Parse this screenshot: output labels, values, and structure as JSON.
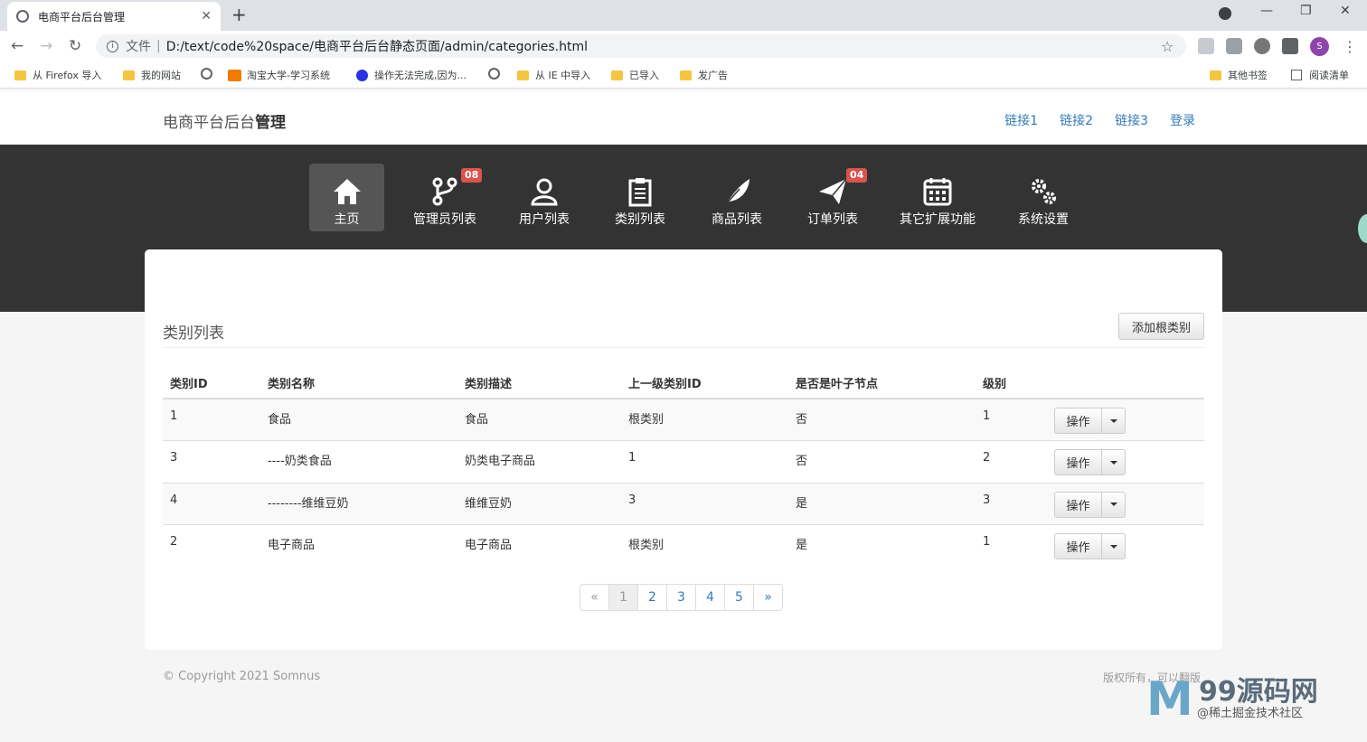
{
  "browser": {
    "tab_title": "电商平台后台管理",
    "url_prefix": "文件",
    "url": "D:/text/code%20space/电商平台后台静态页面/admin/categories.html",
    "avatar_letter": "S",
    "bookmarks": [
      "从 Firefox 导入",
      "我的网站",
      "淘宝大学-学习系统",
      "操作无法完成,因为...",
      "从 IE 中导入",
      "已导入",
      "发广告"
    ],
    "bookmarks_right": [
      "其他书签",
      "阅读清单"
    ]
  },
  "header": {
    "brand_normal": "电商平台后台",
    "brand_bold": "管理",
    "links": [
      "链接1",
      "链接2",
      "链接3",
      "登录"
    ]
  },
  "mainnav": {
    "items": [
      {
        "label": "主页",
        "icon": "home-icon"
      },
      {
        "label": "管理员列表",
        "icon": "branch-icon",
        "badge": "08"
      },
      {
        "label": "用户列表",
        "icon": "users-icon"
      },
      {
        "label": "类别列表",
        "icon": "clipboard-icon"
      },
      {
        "label": "商品列表",
        "icon": "feather-icon"
      },
      {
        "label": "订单列表",
        "icon": "send-icon",
        "badge": "04"
      },
      {
        "label": "其它扩展功能",
        "icon": "calendar-icon"
      },
      {
        "label": "系统设置",
        "icon": "cogs-icon"
      }
    ]
  },
  "card": {
    "title": "类别列表",
    "add_button": "添加根类别"
  },
  "table": {
    "headers": [
      "类别ID",
      "类别名称",
      "类别描述",
      "上一级类别ID",
      "是否是叶子节点",
      "级别",
      ""
    ],
    "rows": [
      [
        "1",
        "食品",
        "食品",
        "根类别",
        "否",
        "1"
      ],
      [
        "3",
        "----奶类食品",
        "奶类电子商品",
        "1",
        "否",
        "2"
      ],
      [
        "4",
        "--------维维豆奶",
        "维维豆奶",
        "3",
        "是",
        "3"
      ],
      [
        "2",
        "电子商品",
        "电子商品",
        "根类别",
        "是",
        "1"
      ]
    ],
    "action_label": "操作"
  },
  "pagination": [
    "«",
    "1",
    "2",
    "3",
    "4",
    "5",
    "»"
  ],
  "footer": {
    "copyright": "© Copyright 2021 Somnus",
    "right": "版权所有，可以翻版"
  },
  "watermark": {
    "mark": "M",
    "title": "99源码网",
    "sub": "@稀土掘金技术社区"
  }
}
